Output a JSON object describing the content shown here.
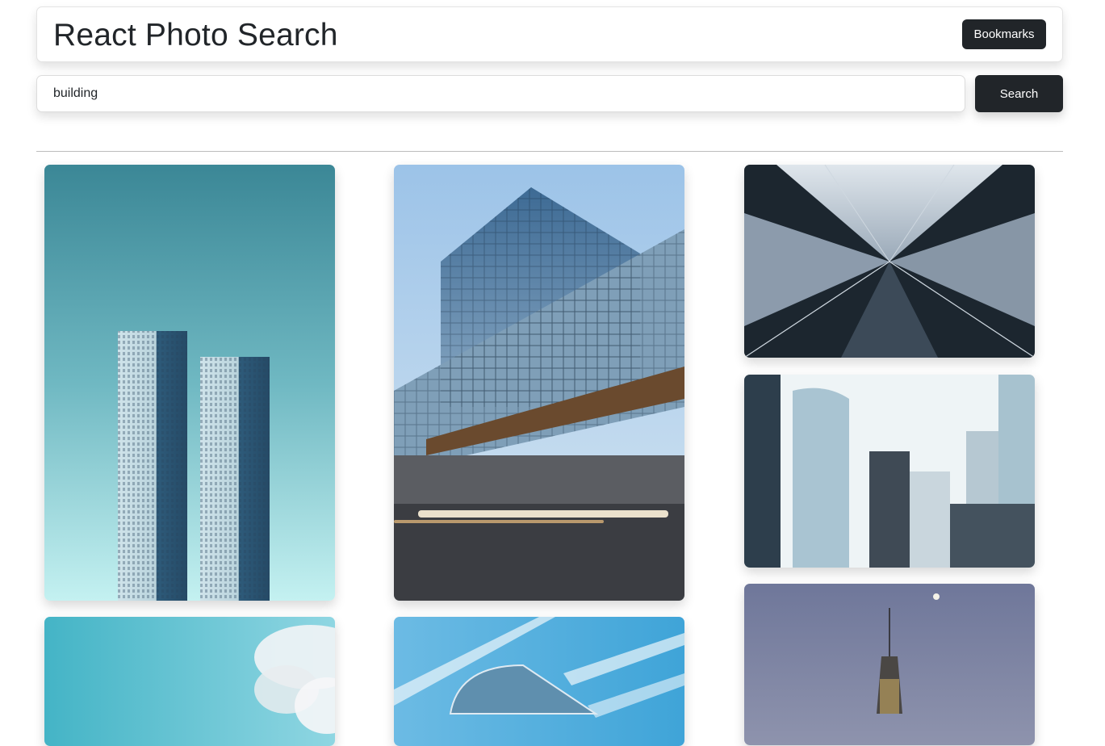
{
  "header": {
    "title": "React Photo Search",
    "bookmarks_label": "Bookmarks"
  },
  "search": {
    "value": "building",
    "button_label": "Search"
  },
  "photos": [
    {
      "subject": "twin-towers-teal-sky"
    },
    {
      "subject": "glass-building-light-trails"
    },
    {
      "subject": "skyscraper-looking-up"
    },
    {
      "subject": "office-towers-white-sky"
    },
    {
      "subject": "sky-and-clouds"
    },
    {
      "subject": "curved-glass-building"
    },
    {
      "subject": "spire-tower-dusk-moon"
    }
  ]
}
